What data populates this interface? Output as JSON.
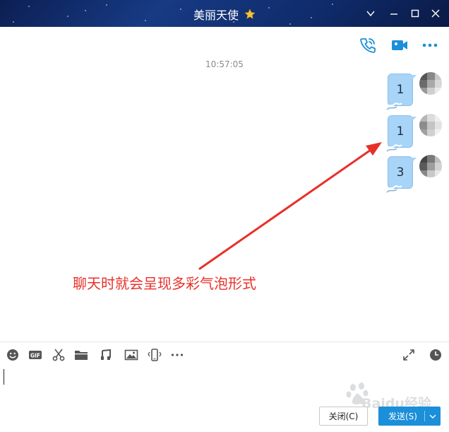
{
  "window": {
    "title": "美丽天使",
    "title_icon": "star-icon",
    "controls": [
      "chevron-down-icon",
      "minimize-icon",
      "maximize-icon",
      "close-icon"
    ]
  },
  "header_actions": [
    "phone-call-icon",
    "video-call-icon",
    "more-icon"
  ],
  "chat": {
    "timestamp": "10:57:05",
    "messages": [
      {
        "text": "1"
      },
      {
        "text": "1"
      },
      {
        "text": "3"
      }
    ]
  },
  "annotation": {
    "text": "聊天时就会呈现多彩气泡形式",
    "color": "#e8302a"
  },
  "toolbar": {
    "left_tools": [
      "emoji-icon",
      "gif-icon",
      "screenshot-scissors-icon",
      "folder-icon",
      "music-icon",
      "image-icon",
      "shake-icon",
      "more-tools-icon"
    ],
    "gif_label": "GIF",
    "right_tools": [
      "expand-icon",
      "history-clock-icon"
    ]
  },
  "input": {
    "value": ""
  },
  "buttons": {
    "close_label": "关闭(C)",
    "send_label": "发送(S)"
  },
  "watermark": {
    "text": "Baidu经验"
  },
  "colors": {
    "accent": "#1b8fd9",
    "bubble": "#a8d4f7",
    "titlebar": "#173a84"
  }
}
